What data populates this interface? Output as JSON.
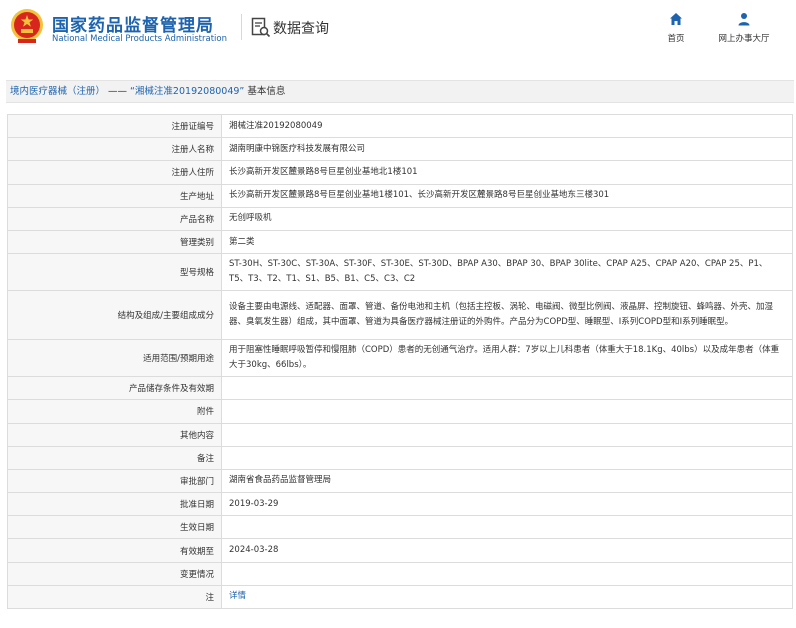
{
  "header": {
    "site_title_cn": "国家药品监督管理局",
    "site_title_en": "National Medical Products Administration",
    "query_title": "数据查询",
    "nav": [
      {
        "label": "首页",
        "icon": "home-icon"
      },
      {
        "label": "网上办事大厅",
        "icon": "user-icon"
      }
    ]
  },
  "breadcrumb": {
    "section": "境内医疗器械（注册）",
    "separator": "——",
    "record": "“湘械注准20192080049”",
    "suffix": "基本信息"
  },
  "fields": [
    {
      "key": "注册证编号",
      "value": "湘械注准20192080049"
    },
    {
      "key": "注册人名称",
      "value": "湖南明康中锦医疗科技发展有限公司"
    },
    {
      "key": "注册人住所",
      "value": "长沙高新开发区麓景路8号巨星创业基地北1楼101"
    },
    {
      "key": "生产地址",
      "value": "长沙高新开发区麓景路8号巨星创业基地1楼101、长沙高新开发区麓景路8号巨星创业基地东三楼301"
    },
    {
      "key": "产品名称",
      "value": "无创呼吸机"
    },
    {
      "key": "管理类别",
      "value": "第二类"
    },
    {
      "key": "型号规格",
      "value": "ST-30H、ST-30C、ST-30A、ST-30F、ST-30E、ST-30D、BPAP A30、BPAP 30、BPAP 30lite、CPAP A25、CPAP A20、CPAP 25、P1、T5、T3、T2、T1、S1、B5、B1、C5、C3、C2"
    },
    {
      "key": "结构及组成/主要组成成分",
      "value": "设备主要由电源线、适配器、面罩、管道、备份电池和主机（包括主控板、涡轮、电磁阀、微型比例阀、液晶屏、控制旋钮、蜂鸣器、外壳、加湿器、臭氧发生器）组成，其中面罩、管道为具备医疗器械注册证的外购件。产品分为COPD型、睡眠型、I系列COPD型和I系列睡眠型。"
    },
    {
      "key": "适用范围/预期用途",
      "value": "用于阻塞性睡眠呼吸暂停和慢阻肺（COPD）患者的无创通气治疗。适用人群：7岁以上儿科患者（体重大于18.1Kg、40lbs）以及成年患者（体重大于30kg、66lbs）。"
    },
    {
      "key": "产品储存条件及有效期",
      "value": ""
    },
    {
      "key": "附件",
      "value": ""
    },
    {
      "key": "其他内容",
      "value": ""
    },
    {
      "key": "备注",
      "value": ""
    },
    {
      "key": "审批部门",
      "value": "湖南省食品药品监督管理局"
    },
    {
      "key": "批准日期",
      "value": "2019-03-29"
    },
    {
      "key": "生效日期",
      "value": ""
    },
    {
      "key": "有效期至",
      "value": "2024-03-28"
    },
    {
      "key": "变更情况",
      "value": ""
    },
    {
      "key": "注",
      "value": "详情"
    }
  ],
  "colors": {
    "brand_blue": "#1e63ad",
    "emblem_red": "#d7261e",
    "emblem_gold": "#f3c13a"
  }
}
